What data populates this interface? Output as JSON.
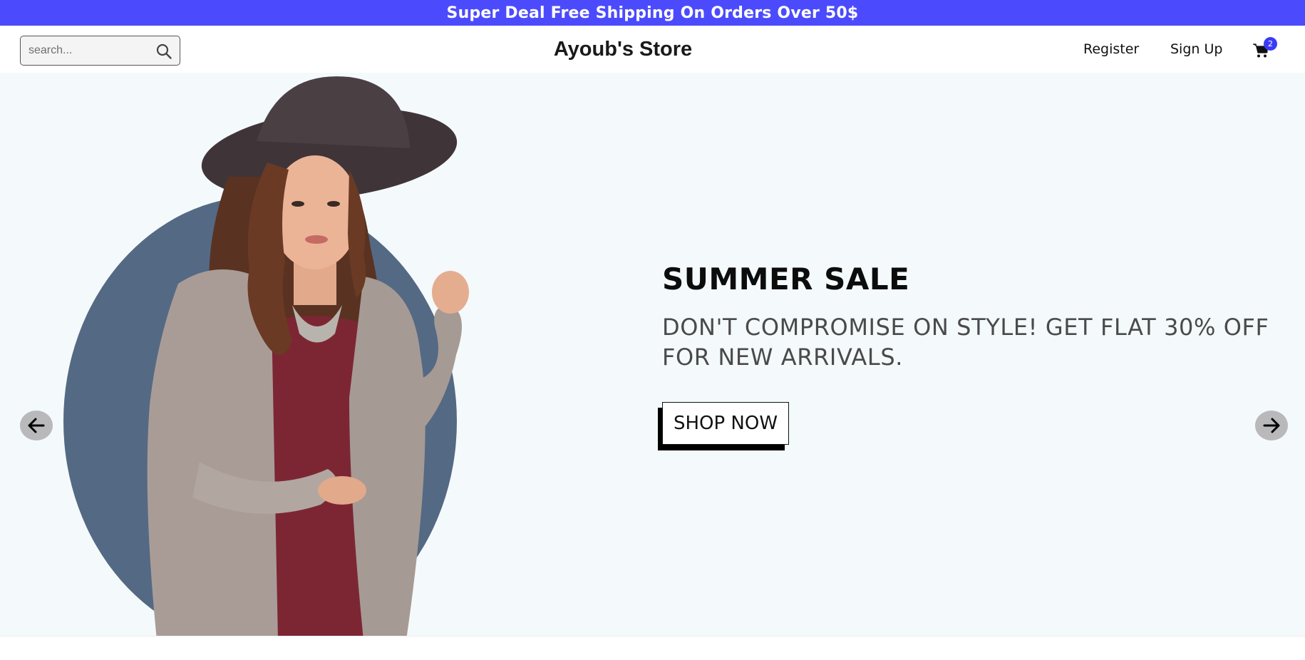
{
  "announcement": {
    "text": "Super Deal Free Shipping On Orders Over 50$"
  },
  "navbar": {
    "search": {
      "placeholder": "search...",
      "value": ""
    },
    "logo": "Ayoub's Store",
    "links": [
      {
        "label": "Register"
      },
      {
        "label": "Sign Up"
      }
    ],
    "cart": {
      "icon": "cart-icon",
      "badge_count": "2"
    }
  },
  "hero": {
    "title": "SUMMER SALE",
    "description": "DON'T COMPROMISE ON STYLE! GET FLAT 30% OFF FOR NEW ARRIVALS.",
    "button_label": "SHOP NOW",
    "prev_icon": "arrow-left-icon",
    "next_icon": "arrow-right-icon"
  },
  "colors": {
    "announcement_bg": "#4b4bfd",
    "hero_bg": "#f4f9fb",
    "circle": "#546983",
    "badge": "#3b3bf5",
    "arrow_bg": "#b9b9bc"
  }
}
